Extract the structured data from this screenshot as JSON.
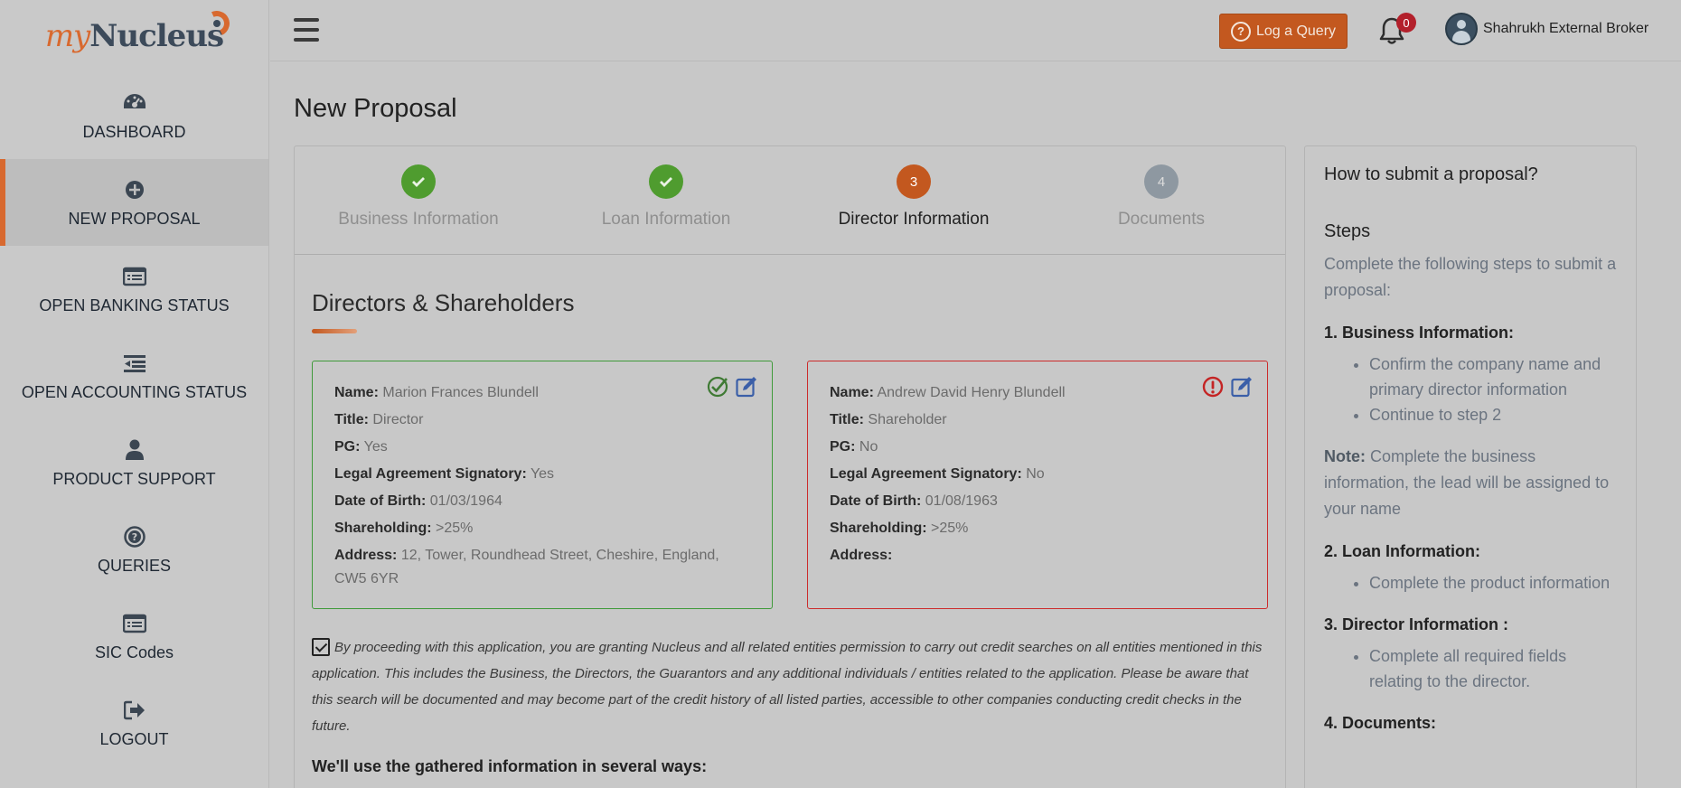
{
  "logo": {
    "my": "my",
    "nucleus": "Nucleus"
  },
  "sidebar": {
    "items": [
      {
        "label": "DASHBOARD",
        "icon": "dashboard-icon"
      },
      {
        "label": "NEW PROPOSAL",
        "icon": "plus-circle-icon",
        "active": true
      },
      {
        "label": "OPEN BANKING STATUS",
        "icon": "list-icon"
      },
      {
        "label": "OPEN ACCOUNTING STATUS",
        "icon": "indent-icon"
      },
      {
        "label": "PRODUCT SUPPORT",
        "icon": "user-icon"
      },
      {
        "label": "QUERIES",
        "icon": "question-circle-icon"
      },
      {
        "label": "SIC Codes",
        "icon": "list-icon"
      },
      {
        "label": "LOGOUT",
        "icon": "sign-out-icon"
      }
    ]
  },
  "topbar": {
    "query_label": "Log a Query",
    "notification_count": "0",
    "user_name": "Shahrukh External Broker"
  },
  "page": {
    "title": "New Proposal"
  },
  "stepper": {
    "steps": [
      {
        "label": "Business Information",
        "state": "done"
      },
      {
        "label": "Loan Information",
        "state": "done"
      },
      {
        "number": "3",
        "label": "Director Information",
        "state": "current"
      },
      {
        "number": "4",
        "label": "Documents",
        "state": "todo"
      }
    ]
  },
  "section": {
    "title": "Directors & Shareholders"
  },
  "directors": [
    {
      "status": "complete",
      "name_label": "Name:",
      "name": "Marion Frances Blundell",
      "title_label": "Title:",
      "title": "Director",
      "pg_label": "PG:",
      "pg": "Yes",
      "signatory_label": "Legal Agreement Signatory:",
      "signatory": "Yes",
      "dob_label": "Date of Birth:",
      "dob": "01/03/1964",
      "shareholding_label": "Shareholding:",
      "shareholding": ">25%",
      "address_label": "Address:",
      "address": "12, Tower, Roundhead Street, Cheshire, England, CW5 6YR"
    },
    {
      "status": "error",
      "name_label": "Name:",
      "name": "Andrew David Henry Blundell",
      "title_label": "Title:",
      "title": "Shareholder",
      "pg_label": "PG:",
      "pg": "No",
      "signatory_label": "Legal Agreement Signatory:",
      "signatory": "No",
      "dob_label": "Date of Birth:",
      "dob": "01/08/1963",
      "shareholding_label": "Shareholding:",
      "shareholding": ">25%",
      "address_label": "Address:",
      "address": ""
    }
  ],
  "consent": {
    "checked": true,
    "text": "By proceeding with this application, you are granting Nucleus and all related entities permission to carry out credit searches on all entities mentioned in this application. This includes the Business, the Directors, the Guarantors and any additional individuals / entities related to the application. Please be aware that this search will be documented and may become part of the credit history of all listed parties, accessible to other companies conducting credit checks in the future."
  },
  "ways_heading": "We'll use the gathered information in several ways:",
  "help": {
    "title": "How to submit a proposal?",
    "steps_heading": "Steps",
    "intro": "Complete the following steps to submit a proposal:",
    "step1_title": "1. Business Information:",
    "step1_items": [
      "Confirm the company name and primary director information",
      "Continue to step 2"
    ],
    "note_label": "Note:",
    "note_text": "Complete the business information, the lead will be assigned to your name",
    "step2_title": "2. Loan Information:",
    "step2_items": [
      "Complete the product information"
    ],
    "step3_title": "3. Director Information :",
    "step3_items": [
      "Complete all required fields relating to the director."
    ],
    "step4_title": "4. Documents:"
  },
  "colors": {
    "accent": "#c3581f",
    "success": "#4f9c2f",
    "error": "#cc2b2b",
    "edit": "#3b5fa8"
  }
}
